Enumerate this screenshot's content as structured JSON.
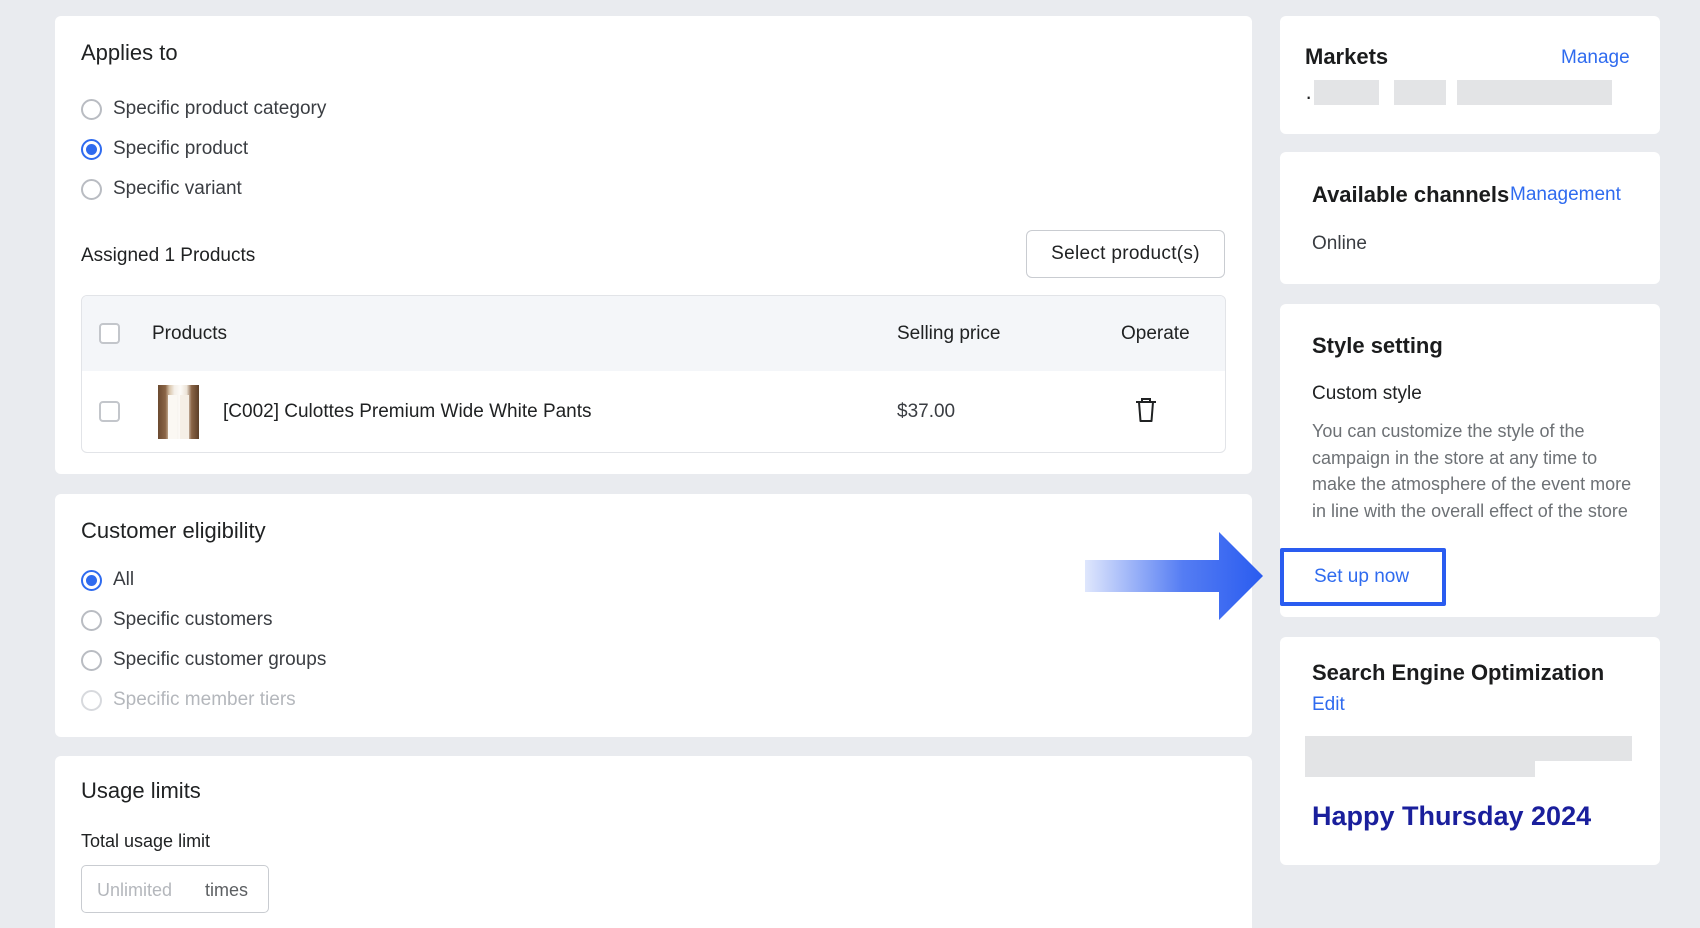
{
  "applies_to": {
    "title": "Applies to",
    "options": [
      "Specific product category",
      "Specific product",
      "Specific variant"
    ],
    "selected_index": 1,
    "assigned_label": "Assigned 1 Products",
    "select_button": "Select product(s)",
    "table": {
      "headers": {
        "products": "Products",
        "price": "Selling price",
        "operate": "Operate"
      },
      "rows": [
        {
          "name": "[C002] Culottes Premium Wide White Pants",
          "price": "$37.00"
        }
      ]
    }
  },
  "eligibility": {
    "title": "Customer eligibility",
    "options": [
      "All",
      "Specific customers",
      "Specific customer groups",
      "Specific member tiers"
    ],
    "selected_index": 0,
    "disabled_index": 3
  },
  "usage": {
    "title": "Usage limits",
    "total_label": "Total usage limit",
    "placeholder": "Unlimited",
    "suffix": "times"
  },
  "markets": {
    "title": "Markets",
    "action": "Manage",
    "bullet": "·"
  },
  "channels": {
    "title": "Available channels",
    "action": "Management",
    "value": "Online"
  },
  "style": {
    "title": "Style setting",
    "subtitle": "Custom style",
    "description": "You can customize the style of the campaign in the store at any time to make the atmosphere of the event more in line with the overall effect of the store",
    "action": "Set up now"
  },
  "seo": {
    "title": "Search Engine Optimization",
    "action": "Edit",
    "headline": "Happy Thursday 2024"
  },
  "colors": {
    "accent": "#2f6bef",
    "highlight_box": "#2a5cf0",
    "seo_headline": "#1a1f9c"
  }
}
